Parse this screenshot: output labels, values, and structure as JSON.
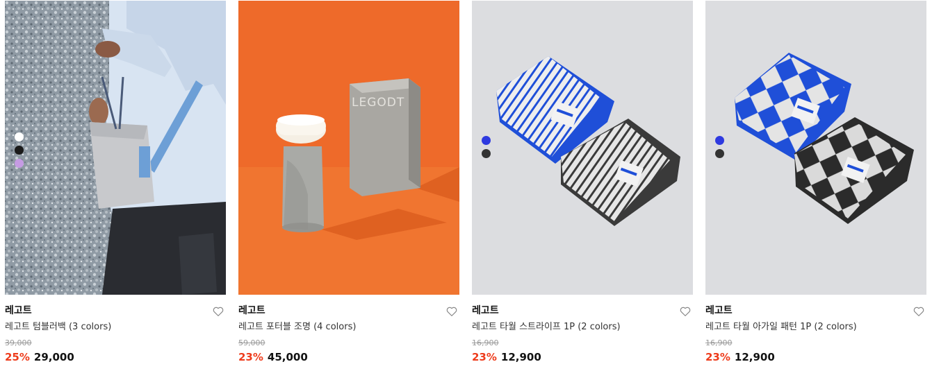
{
  "products": [
    {
      "brand": "레고트",
      "title": "레고트 텀블러백 (3 colors)",
      "original_price": "39,000",
      "discount": "25%",
      "price": "29,000",
      "swatches": [
        "#ffffff",
        "#1a1a1a",
        "#c59be3"
      ]
    },
    {
      "brand": "레고트",
      "title": "레고트 포터블 조명 (4 colors)",
      "original_price": "59,000",
      "discount": "23%",
      "price": "45,000",
      "box_text": "LEGODT"
    },
    {
      "brand": "레고트",
      "title": "레고트 타월 스트라이프 1P (2 colors)",
      "original_price": "16,900",
      "discount": "23%",
      "price": "12,900",
      "swatches": [
        "#2e3ae0",
        "#333333"
      ]
    },
    {
      "brand": "레고트",
      "title": "레고트 타월 아가일 패턴 1P (2 colors)",
      "original_price": "16,900",
      "discount": "23%",
      "price": "12,900",
      "swatches": [
        "#2e3ae0",
        "#333333"
      ]
    }
  ],
  "icons": {
    "wishlist": "heart-outline-icon"
  },
  "colors": {
    "discount": "#ee3c1c",
    "towel_blue": "#1f4fd8",
    "lamp_bg": "#ee6a2a",
    "towel_bg": "#dcdde0"
  }
}
